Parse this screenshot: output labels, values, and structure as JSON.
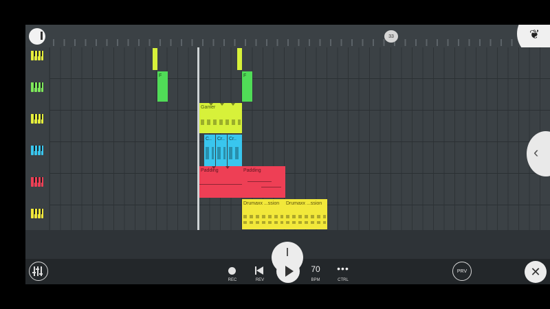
{
  "ruler": {
    "position_marker": "33"
  },
  "tracks": [
    {
      "piano_color": "#e6ef3b",
      "name": "track-1"
    },
    {
      "piano_color": "#7ee85a",
      "name": "track-2"
    },
    {
      "piano_color": "#e6ef3b",
      "name": "track-3"
    },
    {
      "piano_color": "#39c6ee",
      "name": "track-4"
    },
    {
      "piano_color": "#ee3f55",
      "name": "track-5"
    },
    {
      "piano_color": "#f2e83a",
      "name": "track-6"
    }
  ],
  "clips": {
    "green_a": {
      "label": "F",
      "color": "#50dc57"
    },
    "green_b": {
      "label": "F",
      "color": "#50dc57"
    },
    "gamer": {
      "label": "Gamer",
      "color": "#d7f13a"
    },
    "cr1": {
      "label": "C..",
      "color": "#39c6ee"
    },
    "cr2": {
      "label": "Cr..",
      "color": "#39c6ee"
    },
    "cr3": {
      "label": "Cr..",
      "color": "#39c6ee"
    },
    "padding1": {
      "label": "Padding",
      "color": "#ee3f55"
    },
    "padding2": {
      "label": "Padding",
      "color": "#ee3f55"
    },
    "drum1": {
      "label": "Drumaxx ...ssion",
      "color": "#f2e83a"
    },
    "drum2": {
      "label": "Drumaxx ...ssion",
      "color": "#f2e83a"
    }
  },
  "transport": {
    "rec_label": "REC",
    "rev_label": "REV",
    "bpm_value": "70",
    "bpm_label": "BPM",
    "ctrl_label": "CTRL",
    "ctrl_icon": "•••",
    "prv_label": "PRV",
    "close_icon": "✕"
  },
  "side_tab_icon": "‹"
}
